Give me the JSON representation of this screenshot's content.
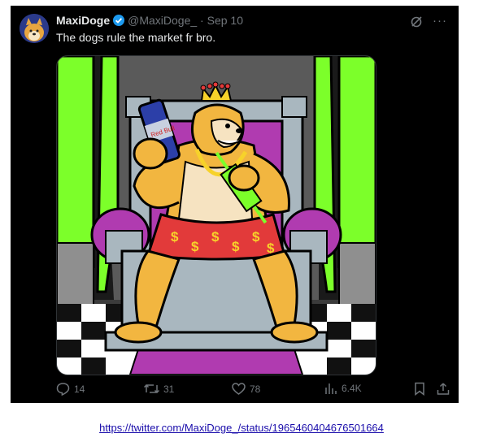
{
  "tweet": {
    "display_name": "MaxiDoge",
    "handle": "@MaxiDoge_",
    "separator": "·",
    "date": "Sep 10",
    "text": "The dogs rule the market fr bro.",
    "verified_color": "#1d9bf0",
    "can_label": "Red Bull"
  },
  "actions": {
    "replies": "14",
    "reposts": "31",
    "likes": "78",
    "views": "6.4K"
  },
  "source_link": "https://twitter.com/MaxiDoge_/status/1965460404676501664",
  "colors": {
    "background": "#000000",
    "text": "#e7e9ea",
    "muted": "#71767b",
    "accent": "#1d9bf0",
    "throne_purple": "#b03bb0",
    "green": "#7cff2a"
  }
}
